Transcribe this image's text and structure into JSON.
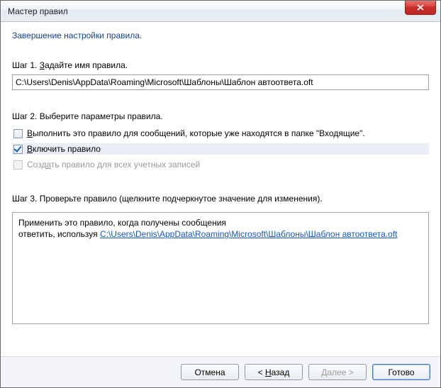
{
  "window": {
    "title": "Мастер правил"
  },
  "subtitle": "Завершение настройки правила.",
  "step1": {
    "prefix": "Шаг 1. ",
    "u": "З",
    "rest": "адайте имя правила.",
    "value": "C:\\Users\\Denis\\AppData\\Roaming\\Microsoft\\Шаблоны\\Шаблон автоответа.oft"
  },
  "step2": {
    "label": "Шаг 2. Выберите параметры правила.",
    "cb_run": {
      "u": "В",
      "rest": "ыполнить это правило для сообщений, которые уже находятся в папке \"Входящие\".",
      "checked": false
    },
    "cb_enable": {
      "u": "В",
      "rest": "ключить правило",
      "checked": true
    },
    "cb_all": {
      "pre": "Созд",
      "u": "а",
      "rest": "ть правило для всех учетных записей",
      "disabled": true
    }
  },
  "step3": {
    "label": "Шаг 3. Проверьте правило (щелкните подчеркнутое значение для изменения).",
    "line1": "Применить это правило, когда получены сообщения",
    "line2_pre": "ответить, используя ",
    "link": "C:\\Users\\Denis\\AppData\\Roaming\\Microsoft\\Шаблоны\\Шаблон автоответа.oft"
  },
  "buttons": {
    "cancel": "Отмена",
    "back_pre": "< ",
    "back_u": "Н",
    "back_rest": "азад",
    "next_u": "Д",
    "next_rest": "алее >",
    "finish": "Готово"
  }
}
